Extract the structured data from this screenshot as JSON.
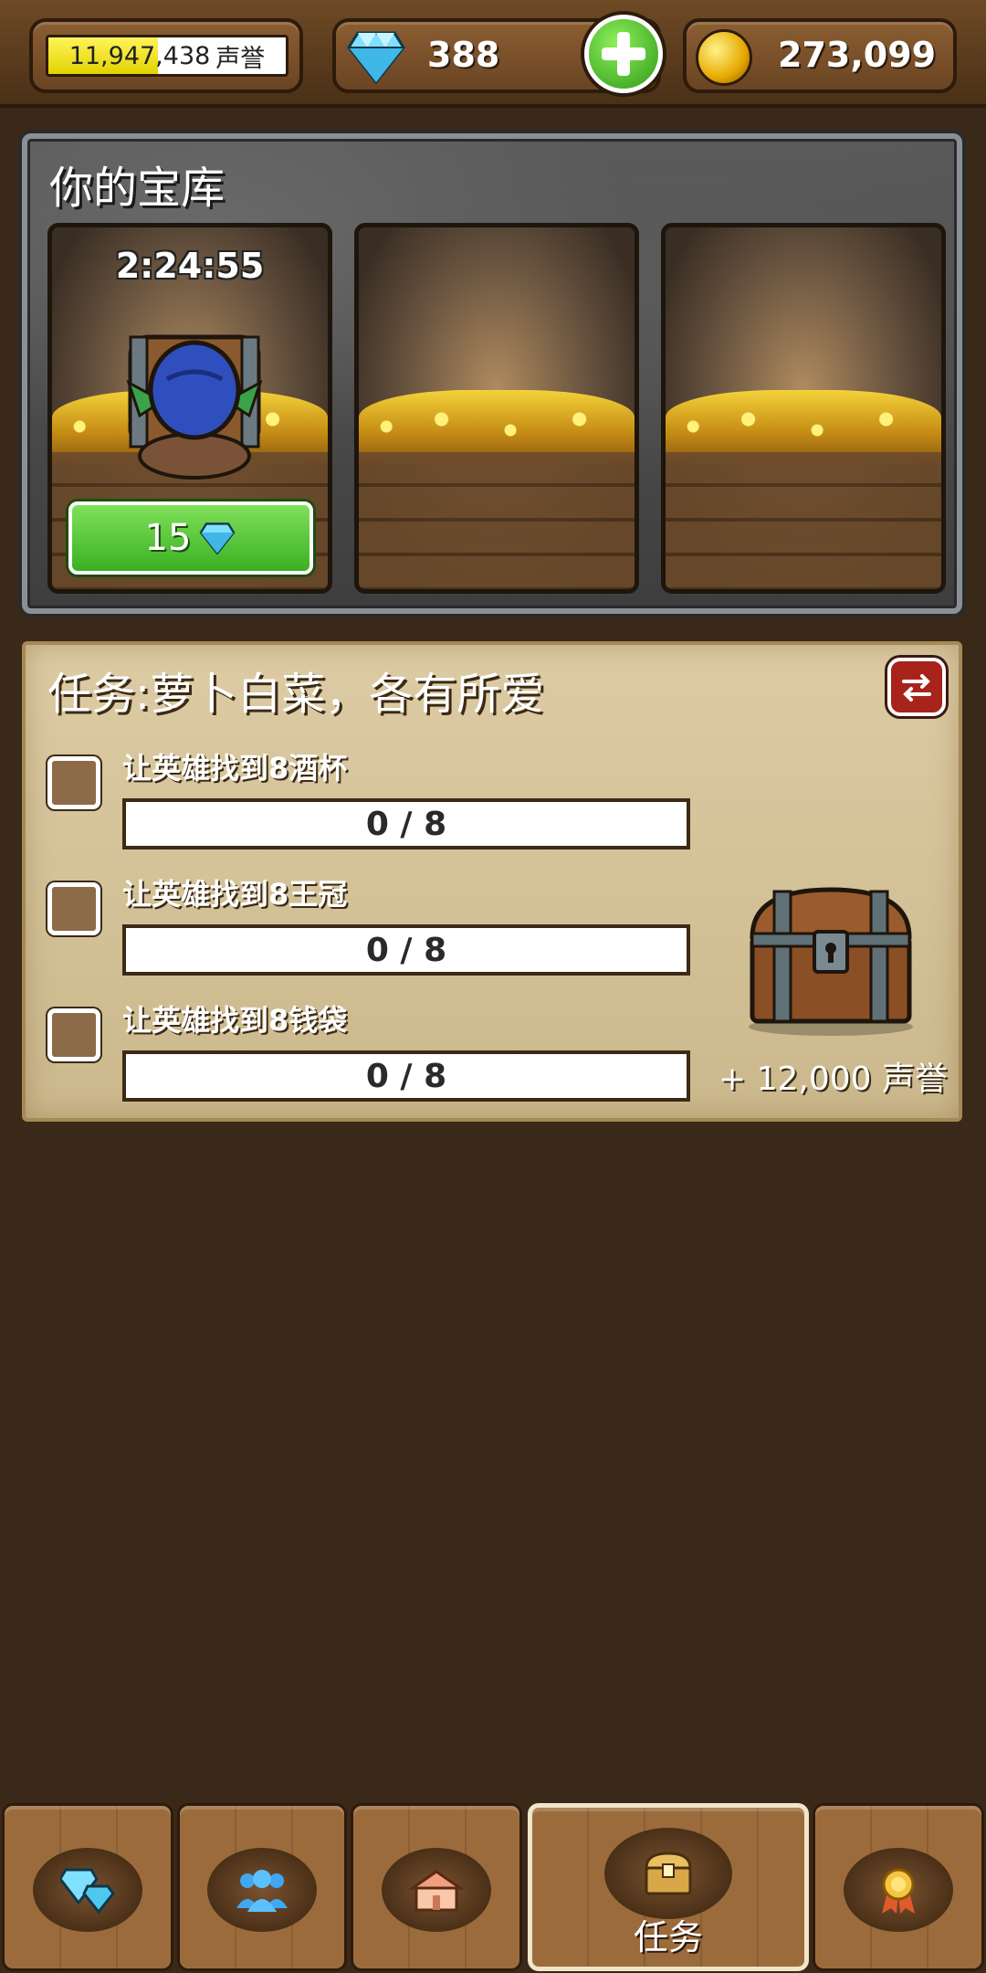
{
  "topbar": {
    "reputation": {
      "value": "11,947,438",
      "unit": "声誉",
      "progress_fraction": 0.46
    },
    "gems": {
      "value": "388",
      "icon": "diamond-icon"
    },
    "add_button_icon": "plus-icon",
    "gold": {
      "value": "273,099",
      "icon": "gold-coin-icon"
    }
  },
  "vault": {
    "title": "你的宝库",
    "slots": [
      {
        "timer": "2:24:55",
        "occupant": "goblin-thief",
        "speedup_cost": "15",
        "speedup_icon": "diamond-icon"
      },
      {
        "state": "empty"
      },
      {
        "state": "empty"
      }
    ]
  },
  "quest": {
    "title": "任务:萝卜白菜，各有所爱",
    "swap_icon": "swap-arrows-icon",
    "tasks": [
      {
        "label": "让英雄找到8酒杯",
        "progress": "0 / 8",
        "current": 0,
        "target": 8
      },
      {
        "label": "让英雄找到8王冠",
        "progress": "0 / 8",
        "current": 0,
        "target": 8
      },
      {
        "label": "让英雄找到8钱袋",
        "progress": "0 / 8",
        "current": 0,
        "target": 8
      }
    ],
    "reward": {
      "text": "+ 12,000 声誉",
      "icon": "treasure-chest-icon"
    }
  },
  "nav": {
    "tabs": [
      {
        "icon": "gems-icon",
        "label": ""
      },
      {
        "icon": "heroes-icon",
        "label": ""
      },
      {
        "icon": "buildings-icon",
        "label": ""
      },
      {
        "icon": "quest-chest-icon",
        "label": "任务",
        "active": true
      },
      {
        "icon": "achievement-medal-icon",
        "label": ""
      }
    ]
  },
  "colors": {
    "background": "#3a2818",
    "accent_green": "#3ab022",
    "reputation_fill": "#f3e600",
    "swap_button": "#a8231a"
  }
}
